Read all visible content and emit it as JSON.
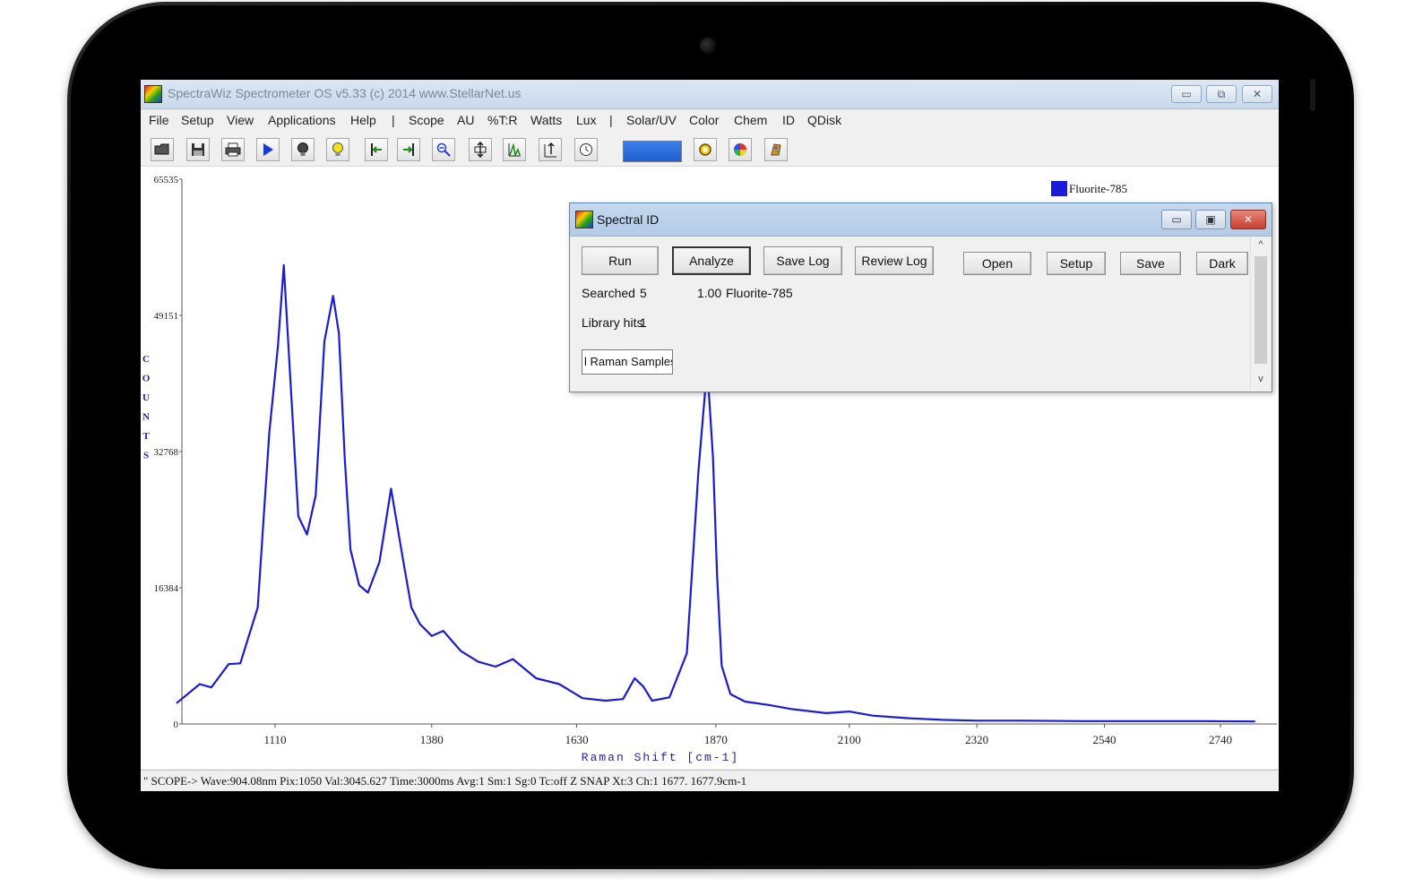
{
  "app": {
    "title": "SpectraWiz  Spectrometer OS v5.33 (c) 2014    www.StellarNet.us",
    "window_buttons": {
      "minimize": "▭",
      "restore": "⧉",
      "close": "✕"
    }
  },
  "menu": {
    "items": [
      "File",
      "Setup",
      "View",
      "Applications",
      "Help",
      "|",
      "Scope",
      "AU",
      "%T:R",
      "Watts",
      "Lux",
      "|",
      "Solar/UV",
      "Color",
      "Chem",
      "ID",
      "QDisk"
    ]
  },
  "toolbar": {
    "icons": [
      "open-folder-icon",
      "save-disk-icon",
      "print-icon",
      "play-icon",
      "bulb-dark-icon",
      "bulb-light-icon",
      "marker-left-icon",
      "marker-right-icon",
      "zoom-out-icon",
      "autoscale-y-icon",
      "peak-icon",
      "peak-up-icon",
      "clock-icon",
      "color-bar",
      "ring-icon",
      "color-wheel-icon",
      "palette-icon"
    ]
  },
  "chart_data": {
    "type": "line",
    "title": "",
    "xlabel": "Raman Shift [cm-1]",
    "ylabel": "COUNTS",
    "xlim": [
      940,
      2800
    ],
    "ylim": [
      0,
      65535
    ],
    "x_ticks": [
      1110,
      1380,
      1630,
      1870,
      2100,
      2320,
      2540,
      2740
    ],
    "y_ticks": [
      0,
      16384,
      32768,
      49151,
      65535
    ],
    "legend_position": "top-right",
    "series": [
      {
        "name": "Fluorite-785",
        "color": "#1a1ad8",
        "x": [
          940,
          980,
          1000,
          1030,
          1050,
          1080,
          1100,
          1115,
          1125,
          1135,
          1150,
          1165,
          1180,
          1195,
          1210,
          1220,
          1230,
          1240,
          1255,
          1270,
          1290,
          1310,
          1330,
          1345,
          1360,
          1380,
          1400,
          1430,
          1460,
          1490,
          1520,
          1560,
          1600,
          1640,
          1680,
          1710,
          1730,
          1745,
          1760,
          1790,
          1820,
          1840,
          1855,
          1865,
          1872,
          1880,
          1895,
          1920,
          1960,
          2000,
          2060,
          2100,
          2140,
          2200,
          2260,
          2320,
          2400,
          2500,
          2600,
          2700,
          2800
        ],
        "y": [
          2500,
          4800,
          4400,
          7200,
          7300,
          14000,
          35000,
          45500,
          55200,
          43000,
          25000,
          22800,
          27500,
          46000,
          51500,
          47000,
          32000,
          21000,
          16700,
          15800,
          19500,
          28300,
          20000,
          14000,
          12000,
          10600,
          11200,
          8800,
          7500,
          6900,
          7800,
          5500,
          4800,
          3100,
          2800,
          3000,
          5500,
          4500,
          2800,
          3200,
          8500,
          30500,
          43000,
          32000,
          18000,
          7000,
          3600,
          2700,
          2300,
          1800,
          1300,
          1500,
          1000,
          700,
          500,
          400,
          400,
          350,
          350,
          350,
          300
        ]
      }
    ]
  },
  "dialog": {
    "title": "Spectral ID",
    "buttons": {
      "run": "Run",
      "analyze": "Analyze",
      "save_log": "Save Log",
      "review_log": "Review Log",
      "open": "Open",
      "setup": "Setup",
      "save": "Save",
      "dark": "Dark"
    },
    "searched_label": "Searched",
    "searched_value": "5",
    "match_score": "1.00",
    "match_name": "Fluorite-785",
    "library_hits_label": "Library hits",
    "library_hits_value": "1",
    "library_field": "l Raman Samples",
    "scroll_up": "^",
    "scroll_down": "v",
    "window_buttons": {
      "minimize": "▭",
      "restore": "▣",
      "close": "✕"
    }
  },
  "status": {
    "text": "\" SCOPE->   Wave:904.08nm  Pix:1050  Val:3045.627 Time:3000ms  Avg:1  Sm:1  Sg:0  Tc:off  Z  SNAP  Xt:3  Ch:1   1677.  1677.9cm-1"
  }
}
